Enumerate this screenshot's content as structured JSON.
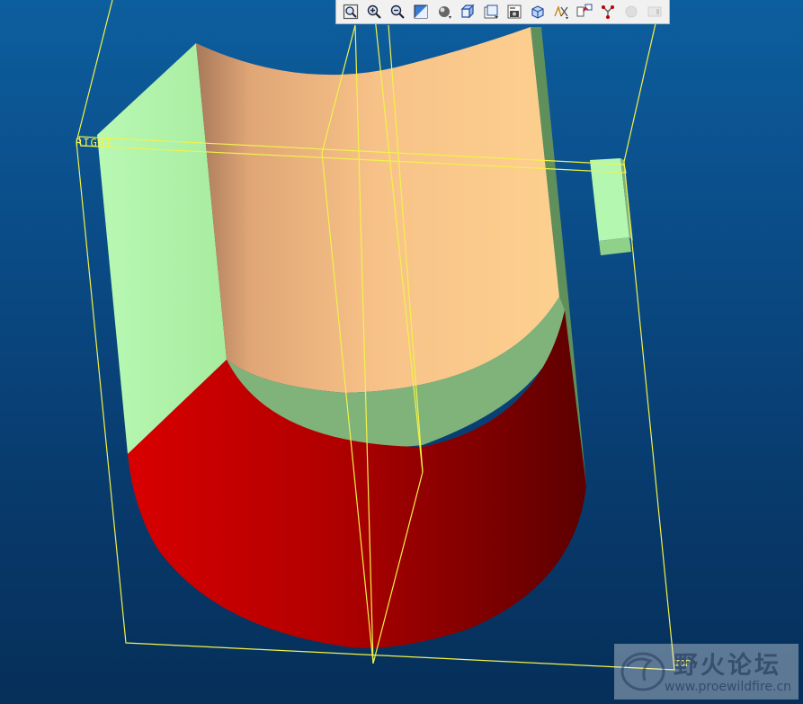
{
  "viewport": {
    "background_top": "#0d5e9e",
    "background_bottom": "#062f59",
    "datum_color": "#f2f24a",
    "surface_colors": {
      "cylinder_top": "#f7c288",
      "cylinder_bottom": "#b00000",
      "plane_faces": "#b4f7b0",
      "ledge": "#7fb37a"
    }
  },
  "toolbar": {
    "buttons": [
      {
        "name": "refit-button",
        "icon": "zoom-fit-icon",
        "enabled": true
      },
      {
        "name": "zoom-in-button",
        "icon": "zoom-in-icon",
        "enabled": true
      },
      {
        "name": "zoom-out-button",
        "icon": "zoom-out-icon",
        "enabled": true
      },
      {
        "name": "repaint-button",
        "icon": "repaint-icon",
        "enabled": true
      },
      {
        "name": "display-style-button",
        "icon": "shading-icon",
        "enabled": true
      },
      {
        "name": "saved-views-button",
        "icon": "view-cube-icon",
        "enabled": true
      },
      {
        "name": "view-manager-button",
        "icon": "view-manager-icon",
        "enabled": true
      },
      {
        "name": "orient-button",
        "icon": "camera-icon",
        "enabled": true
      },
      {
        "name": "named-view-button",
        "icon": "model-box-icon",
        "enabled": true
      },
      {
        "name": "datum-display-button",
        "icon": "datum-display-icon",
        "enabled": true
      },
      {
        "name": "annotation-button",
        "icon": "annotation-icon",
        "enabled": true
      },
      {
        "name": "spin-center-button",
        "icon": "spin-center-icon",
        "enabled": true
      },
      {
        "name": "record-button",
        "icon": "circle-icon",
        "enabled": false
      },
      {
        "name": "pause-button",
        "icon": "pause-icon",
        "enabled": false
      }
    ]
  },
  "datum_labels": {
    "right": "RIGHT",
    "top": "TOP"
  },
  "watermark": {
    "title": "野火论坛",
    "url": "www.proewildfire.cn"
  }
}
